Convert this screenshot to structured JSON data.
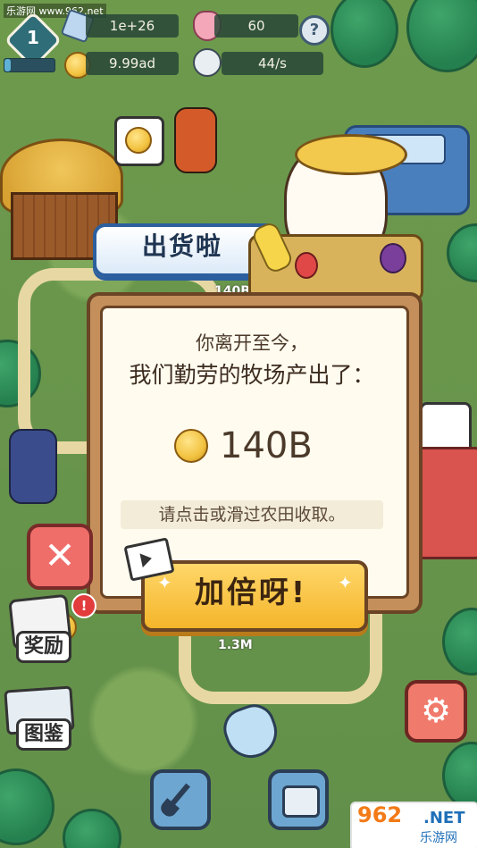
{
  "watermark": "乐游网 www.962.net",
  "hud": {
    "level": "1",
    "level_progress": 0.12,
    "resource_1": "1e+26",
    "gems": "60",
    "coins": "9.99ad",
    "rate": "44/s",
    "help": "?"
  },
  "banner_title": "出货啦",
  "plot_labels": {
    "top": "140B",
    "bottom": "1.3M"
  },
  "dialog": {
    "line1": "你离开至今，",
    "line2": "我们勤劳的牧场产出了：",
    "amount": "140B",
    "hint": "请点击或滑过农田收取。",
    "double_button": "加倍呀!",
    "close_symbol": "✕"
  },
  "side_menu": {
    "rewards": "奖励",
    "rewards_badge": "!",
    "collection": "图鉴"
  },
  "site_logo": {
    "big": "962",
    "net": ".NET",
    "cn": "乐游网"
  },
  "colors": {
    "accent_yellow": "#f4b52a",
    "panel_brown": "#c58f5b",
    "close_red": "#f06e6a",
    "banner_blue": "#2c5f9e"
  }
}
